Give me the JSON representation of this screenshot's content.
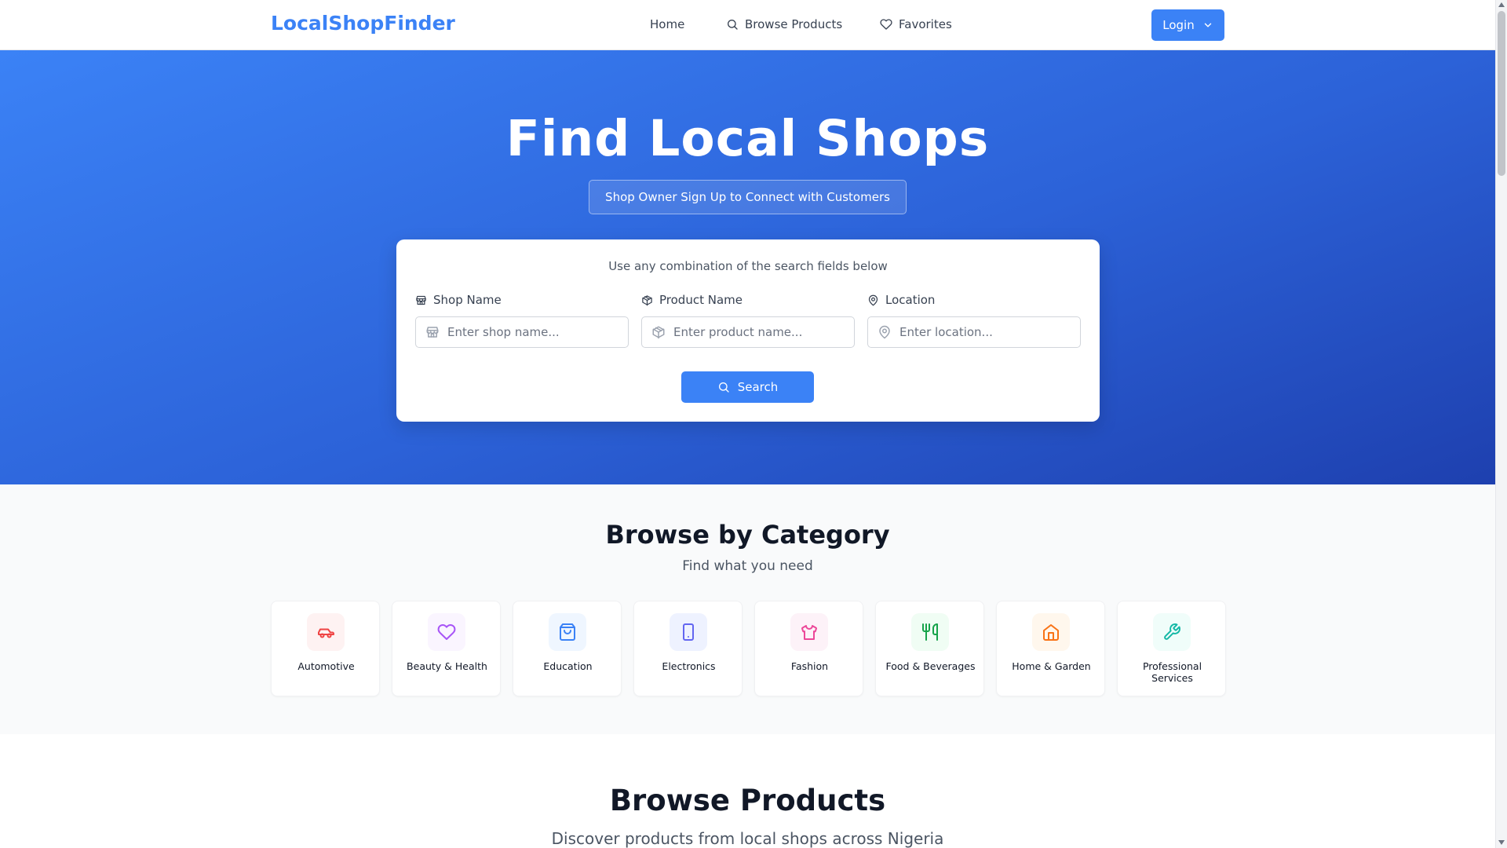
{
  "header": {
    "brand": "LocalShopFinder",
    "nav": {
      "home": "Home",
      "browse_products": "Browse Products",
      "favorites": "Favorites"
    },
    "login_label": "Login"
  },
  "hero": {
    "title": "Find Local Shops",
    "signup_label": "Shop Owner Sign Up to Connect with Customers",
    "search": {
      "hint": "Use any combination of the search fields below",
      "shop_name_label": "Shop Name",
      "shop_name_placeholder": "Enter shop name...",
      "shop_name_value": "",
      "product_name_label": "Product Name",
      "product_name_placeholder": "Enter product name...",
      "product_name_value": "",
      "location_label": "Location",
      "location_placeholder": "Enter location...",
      "location_value": "",
      "search_label": "Search"
    }
  },
  "categories": {
    "title": "Browse by Category",
    "subtitle": "Find what you need",
    "items": [
      {
        "label": "Automotive",
        "icon": "car-icon",
        "color": "#ef4444",
        "bg": "#fef2f2"
      },
      {
        "label": "Beauty & Health",
        "icon": "heart-icon",
        "color": "#a855f7",
        "bg": "#faf5ff"
      },
      {
        "label": "Education",
        "icon": "shopping-bag-icon",
        "color": "#3b82f6",
        "bg": "#eff6ff"
      },
      {
        "label": "Electronics",
        "icon": "tablet-icon",
        "color": "#6366f1",
        "bg": "#eef2ff"
      },
      {
        "label": "Fashion",
        "icon": "shirt-icon",
        "color": "#ec4899",
        "bg": "#fdf2f8"
      },
      {
        "label": "Food & Beverages",
        "icon": "utensils-icon",
        "color": "#16a34a",
        "bg": "#f0fdf4"
      },
      {
        "label": "Home & Garden",
        "icon": "home-icon",
        "color": "#f97316",
        "bg": "#fff7ed"
      },
      {
        "label": "Professional Services",
        "icon": "wrench-icon",
        "color": "#14b8a6",
        "bg": "#f0fdfa"
      }
    ]
  },
  "products": {
    "title": "Browse Products",
    "subtitle": "Discover products from local shops across Nigeria"
  },
  "colors": {
    "accent": "#3b82f6",
    "hero_gradient_start": "#3b82f6",
    "hero_gradient_end": "#1e40af"
  }
}
